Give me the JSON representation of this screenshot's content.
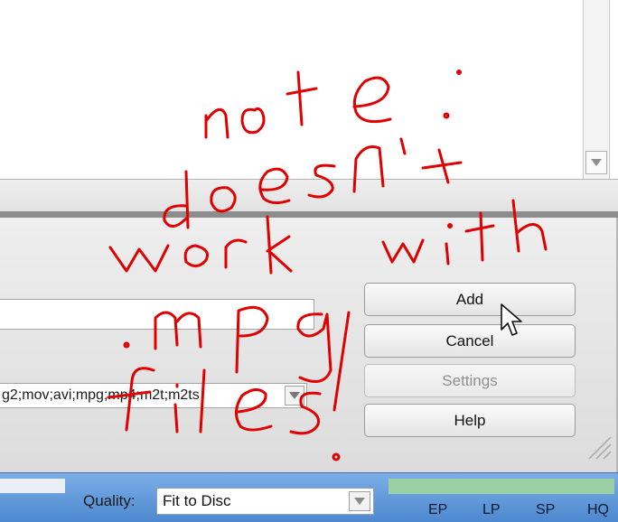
{
  "buttons": {
    "add": "Add",
    "cancel": "Cancel",
    "settings": "Settings",
    "help": "Help"
  },
  "file_types": {
    "value": "g2;mov;avi;mpg;mp4;m2t;m2ts"
  },
  "status_bar": {
    "quality_label": "Quality:",
    "quality_value": "Fit to Disc",
    "modes": [
      "EP",
      "LP",
      "SP",
      "HQ"
    ]
  },
  "annotation": {
    "text": "note: doesn't work with .mpg files!"
  },
  "colors": {
    "annotation_ink": "#e00000",
    "status_bar": "#5a93d6",
    "meter": "#9ad0a4"
  },
  "icons": [
    "scroll-down-arrow-icon",
    "dropdown-arrow-icon",
    "mouse-cursor-icon",
    "resize-grip-icon"
  ]
}
